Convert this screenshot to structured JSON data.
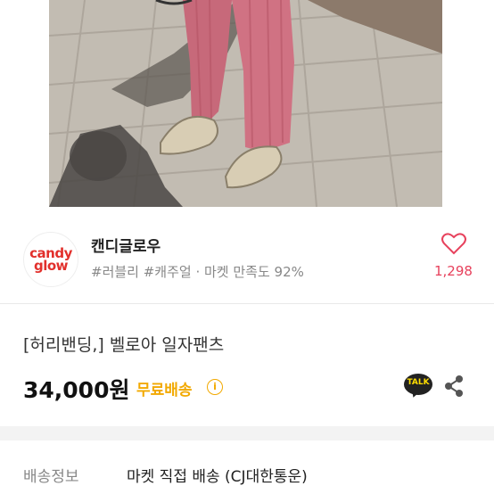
{
  "shop": {
    "logo_line1": "candy",
    "logo_line2": "glow",
    "name": "캔디글로우",
    "tags": "#러블리 #캐주얼 · 마켓 만족도 92%",
    "likes": "1,298",
    "accent_color": "#e7415c"
  },
  "product": {
    "title": "[허리밴딩,] 벨로아 일자팬츠",
    "price": "34,000원",
    "shipping_badge": "무료배송",
    "shipping_badge_color": "#f2a900",
    "talk_label": "TALK"
  },
  "delivery": {
    "label": "배송정보",
    "value": "마켓 직접 배송 (CJ대한통운)"
  },
  "icons": [
    "heart-icon",
    "info-icon",
    "kakaotalk-icon",
    "share-icon"
  ]
}
